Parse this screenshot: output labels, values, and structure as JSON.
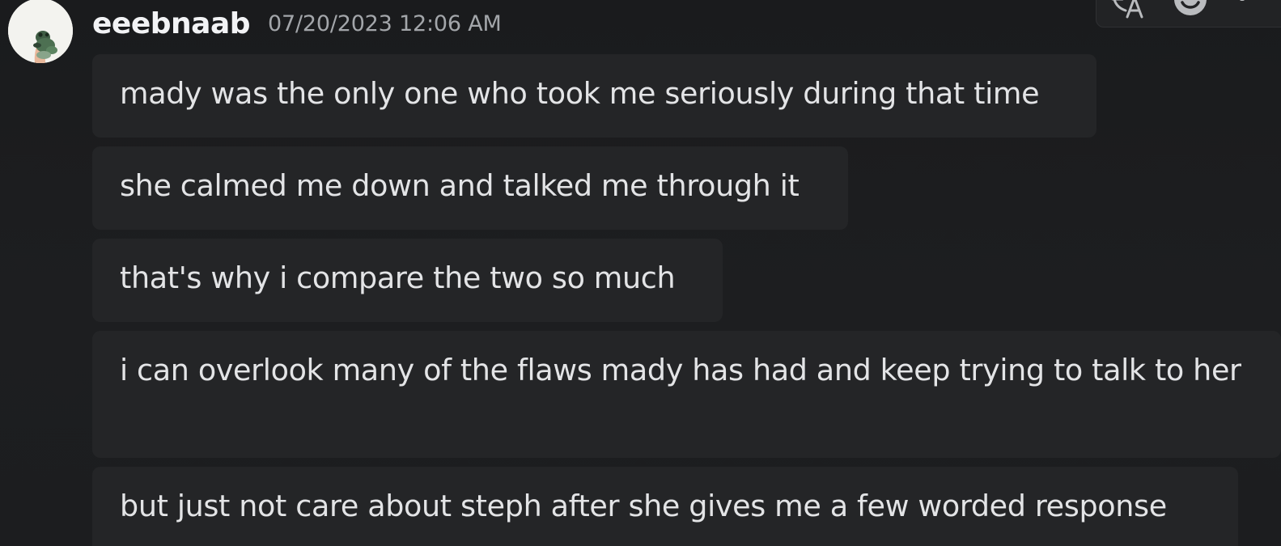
{
  "message_group": {
    "author": {
      "username": "eeebnaab",
      "avatar_icon": "frog-avatar"
    },
    "timestamp": "07/20/2023 12:06 AM",
    "messages": [
      "mady was the only one who took me seriously during that time",
      "she calmed me down and talked me through it",
      "that's why i compare the two so much",
      "i can overlook many of the flaws mady has had and keep trying to talk to her",
      "but just not care about steph after she gives me a few worded response"
    ]
  },
  "hover_toolbar": {
    "icons": [
      "translate-icon",
      "emoji-reaction-icon",
      "more-options-icon"
    ]
  },
  "colors": {
    "background": "#1c1d1f",
    "message_bubble": "#242527",
    "username": "#f2f3f5",
    "timestamp": "#a3a6aa",
    "text": "#e3e4e6"
  }
}
